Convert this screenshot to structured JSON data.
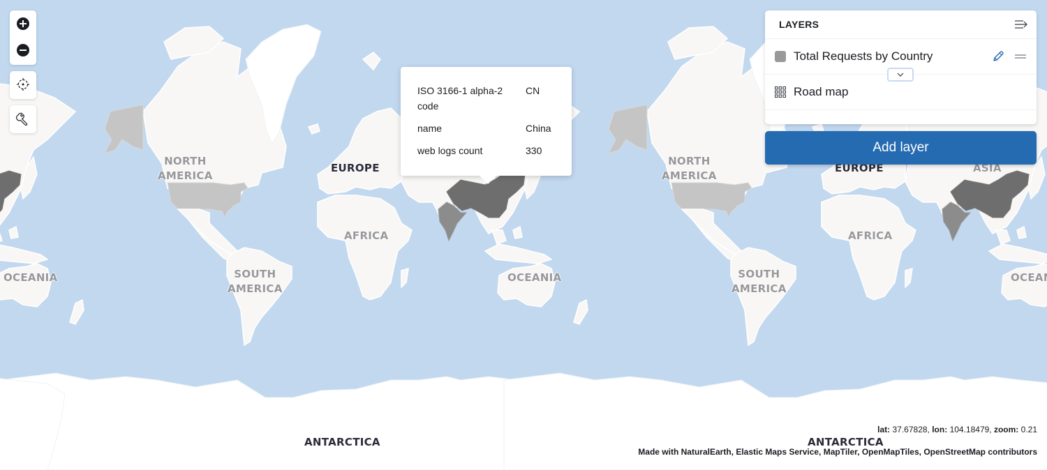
{
  "map": {
    "continent_labels": [
      {
        "text_line1": "NORTH",
        "text_line2": "AMERICA"
      },
      {
        "text_line1": "EUROPE",
        "text_line2": ""
      },
      {
        "text_line1": "AFRICA",
        "text_line2": ""
      },
      {
        "text_line1": "SOUTH",
        "text_line2": "AMERICA"
      },
      {
        "text_line1": "OCEANIA",
        "text_line2": ""
      },
      {
        "text_line1": "ANTARCTICA",
        "text_line2": ""
      },
      {
        "text_line1": "ASIA",
        "text_line2": ""
      }
    ],
    "highlighted_countries": [
      {
        "name": "China",
        "fill": "#6e6e6e"
      },
      {
        "name": "India",
        "fill": "#8c8c8c"
      },
      {
        "name": "United States",
        "fill": "#c5c5c5"
      },
      {
        "name": "Canada (Alaska region)",
        "fill": "#c5c5c5"
      }
    ],
    "ocean_color": "#c2d8ef",
    "land_color": "#f8f7f5"
  },
  "toolbar": {
    "zoom_in": {
      "icon": "plus-circle-icon",
      "label": "Zoom in"
    },
    "zoom_out": {
      "icon": "minus-circle-icon",
      "label": "Zoom out"
    },
    "set_view": {
      "icon": "crosshair-icon",
      "label": "Set view"
    },
    "tools": {
      "icon": "wrench-icon",
      "label": "Tools"
    }
  },
  "layers_panel": {
    "title": "LAYERS",
    "collapse_icon": "collapse-panel-icon",
    "layers": [
      {
        "name": "Total Requests by Country",
        "swatch_color": "#999999",
        "icon": "swatch",
        "actions": [
          "edit",
          "drag"
        ]
      },
      {
        "name": "Road map",
        "icon": "grid-icon",
        "actions": []
      }
    ],
    "add_layer_label": "Add layer",
    "add_layer_color": "#256bb1"
  },
  "tooltip": {
    "rows": [
      {
        "key": "ISO 3166-1 alpha-2 code",
        "value": "CN"
      },
      {
        "key": "name",
        "value": "China"
      },
      {
        "key": "web logs count",
        "value": "330"
      }
    ]
  },
  "status": {
    "lat_label": "lat:",
    "lat": "37.67828",
    "lon_label": "lon:",
    "lon": "104.18479",
    "zoom_label": "zoom:",
    "zoom": "0.21",
    "attribution": "Made with NaturalEarth, Elastic Maps Service, MapTiler, OpenMapTiles, OpenStreetMap contributors"
  }
}
